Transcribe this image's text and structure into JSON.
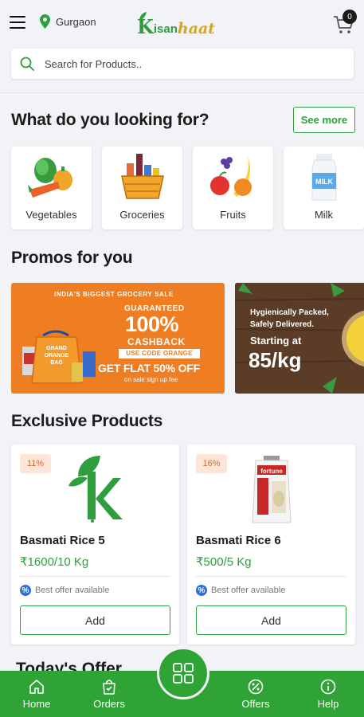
{
  "header": {
    "location": "Gurgaon",
    "logo": {
      "k": "K",
      "isan": "isan",
      "haat": "haat"
    },
    "cart_count": "0"
  },
  "search": {
    "placeholder": "Search for Products.."
  },
  "categories_section": {
    "title": "What do you looking for?",
    "see_more_label": "See more",
    "items": [
      {
        "label": "Vegetables",
        "icon": "vegetables-icon"
      },
      {
        "label": "Groceries",
        "icon": "groceries-basket-icon"
      },
      {
        "label": "Fruits",
        "icon": "fruits-icon"
      },
      {
        "label": "Milk",
        "icon": "milk-bottle-icon"
      }
    ]
  },
  "promos": {
    "title": "Promos for you",
    "promo1": {
      "headline": "INDIA'S BIGGEST GROCERY SALE",
      "guaranteed": "GUARANTEED",
      "big": "100%",
      "cashback": "CASHBACK",
      "code": "USE CODE ORANGE",
      "flat": "GET FLAT 50% OFF",
      "note": "on sale sign up fee",
      "bag_label": "GRAND ORANGE BAG"
    },
    "promo2": {
      "line1": "Hygienically Packed,",
      "line2": "Safely Delivered.",
      "starting": "Starting at",
      "price": "85/kg"
    }
  },
  "exclusive": {
    "title": "Exclusive Products",
    "products": [
      {
        "discount": "11%",
        "name": "Basmati Rice 5",
        "price": "₹1600/10 Kg",
        "offer": "Best offer available",
        "add_label": "Add",
        "image": "kisanhaat-k-logo"
      },
      {
        "discount": "16%",
        "name": "Basmati Rice 6",
        "price": "₹500/5 Kg",
        "offer": "Best offer available",
        "add_label": "Add",
        "image": "fortune-rice-bag"
      }
    ]
  },
  "todays_offer": {
    "title": "Today's Offer"
  },
  "bottom_nav": [
    {
      "label": "Home",
      "icon": "home-icon"
    },
    {
      "label": "Orders",
      "icon": "orders-bag-icon"
    },
    {
      "label": "Offers",
      "icon": "offers-percent-icon"
    },
    {
      "label": "Help",
      "icon": "help-info-icon"
    }
  ],
  "colors": {
    "brand_green": "#2fa336",
    "promo_orange": "#ef7d22",
    "logo_gold": "#d6a521",
    "background": "#f1f3f7"
  }
}
